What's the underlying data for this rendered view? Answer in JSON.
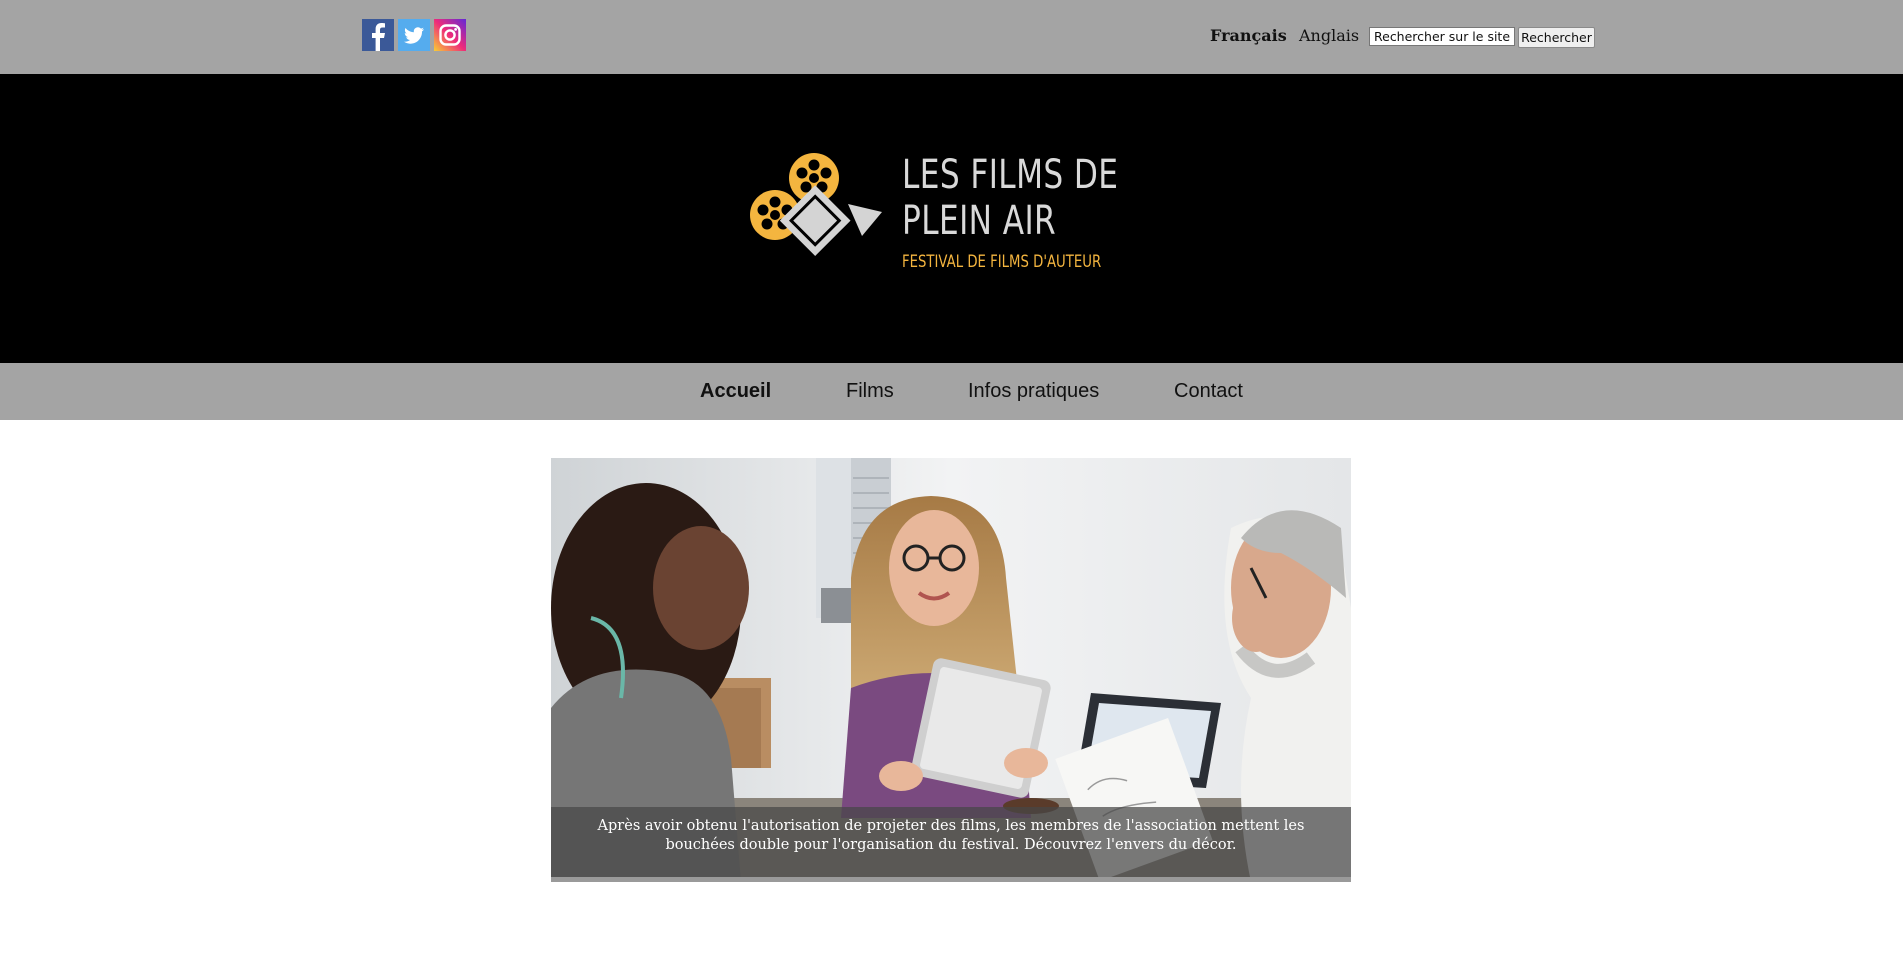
{
  "social": {
    "facebook": "facebook-icon",
    "twitter": "twitter-icon",
    "instagram": "instagram-icon"
  },
  "languages": {
    "current": "Français",
    "other": "Anglais"
  },
  "search": {
    "placeholder": "Rechercher sur le site",
    "button_label": "Rechercher"
  },
  "logo": {
    "line1": "LES FILMS DE",
    "line2": "PLEIN AIR",
    "tagline": "FESTIVAL DE FILMS D'AUTEUR",
    "accent_color": "#f4b53f"
  },
  "nav": {
    "items": [
      {
        "label": "Accueil",
        "active": true
      },
      {
        "label": "Films",
        "active": false
      },
      {
        "label": "Infos pratiques",
        "active": false
      },
      {
        "label": "Contact",
        "active": false
      }
    ]
  },
  "hero": {
    "caption": "Après avoir obtenu l'autorisation de projeter des films, les membres de l'association mettent les bouchées double pour l'organisation du festival. Découvrez l'envers du décor."
  },
  "colors": {
    "bar": "#a4a4a4",
    "banner": "#000000"
  }
}
